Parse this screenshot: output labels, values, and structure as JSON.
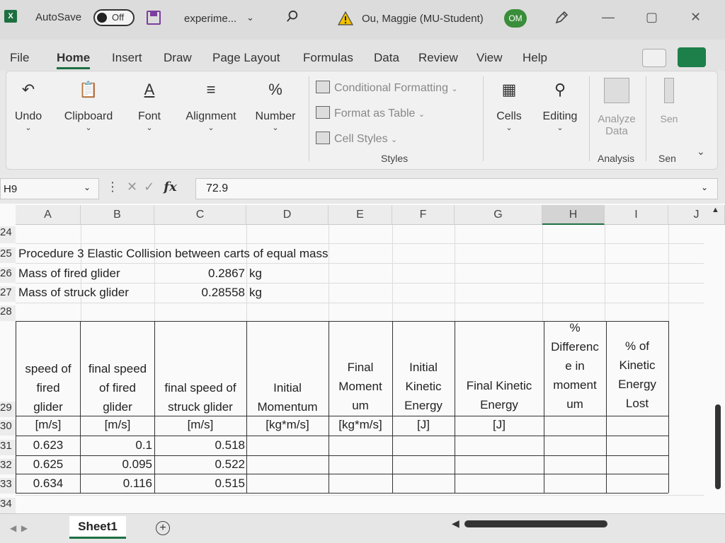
{
  "titlebar": {
    "autosave_label": "AutoSave",
    "autosave_state": "Off",
    "filename": "experime...",
    "user": "Ou, Maggie (MU-Student)",
    "avatar_initials": "OM"
  },
  "menu": {
    "tabs": [
      "File",
      "Home",
      "Insert",
      "Draw",
      "Page Layout",
      "Formulas",
      "Data",
      "Review",
      "View",
      "Help"
    ],
    "active": "Home"
  },
  "ribbon": {
    "undo": "Undo",
    "clipboard": "Clipboard",
    "font": "Font",
    "alignment": "Alignment",
    "number": "Number",
    "conditional_formatting": "Conditional Formatting",
    "format_as_table": "Format as Table",
    "cell_styles": "Cell Styles",
    "styles_group": "Styles",
    "cells": "Cells",
    "editing": "Editing",
    "analyze_data_1": "Analyze",
    "analyze_data_2": "Data",
    "analysis_group": "Analysis",
    "sensitivity": "Sen",
    "sensitivity_group": "Sen"
  },
  "formula_bar": {
    "name_box": "H9",
    "value": "72.9"
  },
  "columns": [
    "A",
    "B",
    "C",
    "D",
    "E",
    "F",
    "G",
    "H",
    "I",
    "J"
  ],
  "selected_column": "H",
  "row_numbers": [
    "24",
    "25",
    "26",
    "27",
    "28",
    "29",
    "30",
    "31",
    "32",
    "33",
    "34"
  ],
  "sheet": {
    "r25": "Procedure 3 Elastic Collision between carts of equal mass",
    "r26_label": "Mass of fired glider",
    "r26_value": "0.2867",
    "r26_unit": "kg",
    "r27_label": "Mass of struck glider",
    "r27_value": "0.28558",
    "r27_unit": "kg",
    "headers": {
      "a": [
        "speed of",
        "fired",
        "glider"
      ],
      "b": [
        "final speed",
        "of fired",
        "glider"
      ],
      "c": [
        "final speed of",
        "struck glider"
      ],
      "d": [
        "Initial",
        "Momentum"
      ],
      "e": [
        "Final",
        "Moment",
        "um"
      ],
      "f": [
        "Initial",
        "Kinetic",
        "Energy"
      ],
      "g": [
        "Final Kinetic",
        "Energy"
      ],
      "h": [
        "%",
        "Differenc",
        "e in",
        "moment",
        "um"
      ],
      "i": [
        "% of",
        "Kinetic",
        "Energy",
        "Lost"
      ]
    },
    "units": {
      "a": "[m/s]",
      "b": "[m/s]",
      "c": "[m/s]",
      "d": "[kg*m/s]",
      "e": "[kg*m/s]",
      "f": "[J]",
      "g": "[J]"
    },
    "rows": [
      {
        "a": "0.623",
        "b": "0.1",
        "c": "0.518"
      },
      {
        "a": "0.625",
        "b": "0.095",
        "c": "0.522"
      },
      {
        "a": "0.634",
        "b": "0.116",
        "c": "0.515"
      }
    ]
  },
  "bottom": {
    "sheet_tab": "Sheet1"
  }
}
